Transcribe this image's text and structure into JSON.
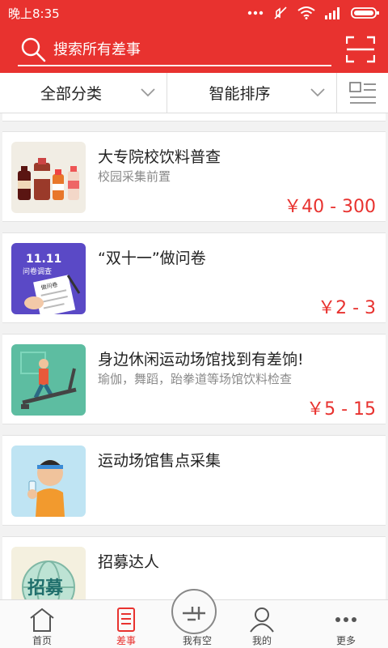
{
  "status_bar": {
    "time": "晚上8:35"
  },
  "search": {
    "placeholder": "搜索所有差事"
  },
  "filters": {
    "category": "全部分类",
    "sort": "智能排序"
  },
  "tasks": [
    {
      "title": "大专院校饮料普查",
      "subtitle": "校园采集前置",
      "price": "￥40 - 300"
    },
    {
      "title": "“双十一”做问卷",
      "subtitle": "",
      "price": "￥2 - 3"
    },
    {
      "title": "身边休闲运动场馆找到有差饷!",
      "subtitle": "瑜伽，舞蹈，跆拳道等场馆饮料检查",
      "price": "￥5 - 15"
    },
    {
      "title": "运动场馆售点采集",
      "subtitle": "",
      "price": ""
    },
    {
      "title": "招募达人",
      "subtitle": "",
      "price": ""
    }
  ],
  "thumbs": {
    "double11_text": "11.11",
    "double11_sub": "问卷调查",
    "survey_paper": "做问卷",
    "recruit_text": "招募"
  },
  "tabs": [
    {
      "label": "首页",
      "icon": "home-icon"
    },
    {
      "label": "差事",
      "icon": "task-list-icon",
      "active": true
    },
    {
      "label": "我有空",
      "icon": "free-time-icon"
    },
    {
      "label": "我的",
      "icon": "user-icon"
    },
    {
      "label": "更多",
      "icon": "more-icon"
    }
  ],
  "colors": {
    "brand": "#e8322f",
    "price": "#e8322f"
  }
}
